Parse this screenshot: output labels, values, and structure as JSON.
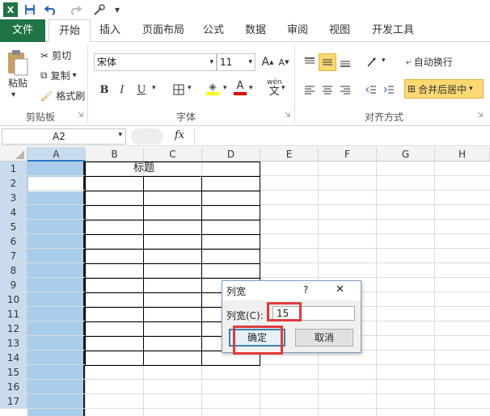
{
  "qat": {
    "app_icon": "excel-icon",
    "items": [
      "save-icon",
      "undo-icon",
      "redo-icon",
      "tools-icon",
      "customize-icon"
    ]
  },
  "tabs": [
    "文件",
    "开始",
    "插入",
    "页面布局",
    "公式",
    "数据",
    "审阅",
    "视图",
    "开发工具"
  ],
  "ribbon": {
    "clipboard": {
      "paste": "粘贴",
      "cut": "剪切",
      "copy": "复制",
      "format_painter": "格式刷",
      "group_label": "剪贴板"
    },
    "font": {
      "font_name": "宋体",
      "font_size": "11",
      "bold": "B",
      "italic": "I",
      "underline": "U",
      "grow": "A",
      "shrink": "A",
      "font_color_letter": "A",
      "wen": "wén",
      "wen2": "文",
      "group_label": "字体"
    },
    "alignment": {
      "wrap_text": "自动换行",
      "merge_center": "合并后居中",
      "group_label": "对齐方式"
    }
  },
  "formula_bar": {
    "name_box": "A2",
    "fx": "fx",
    "content": ""
  },
  "grid": {
    "columns": [
      "A",
      "B",
      "C",
      "D",
      "E",
      "F",
      "G",
      "H"
    ],
    "rows": [
      "1",
      "2",
      "3",
      "4",
      "5",
      "6",
      "7",
      "8",
      "9",
      "10",
      "11",
      "12",
      "13",
      "14",
      "15",
      "16",
      "17"
    ],
    "title_cell": "标题"
  },
  "dialog": {
    "title": "列宽",
    "help": "?",
    "close": "✕",
    "label": "列宽(C):",
    "value": "15",
    "ok": "确定",
    "cancel": "取消"
  },
  "colors": {
    "file_tab": "#1f7345",
    "selection": "#a9cdea",
    "highlight": "#e23b3b",
    "merge_btn": "#fbd872"
  }
}
